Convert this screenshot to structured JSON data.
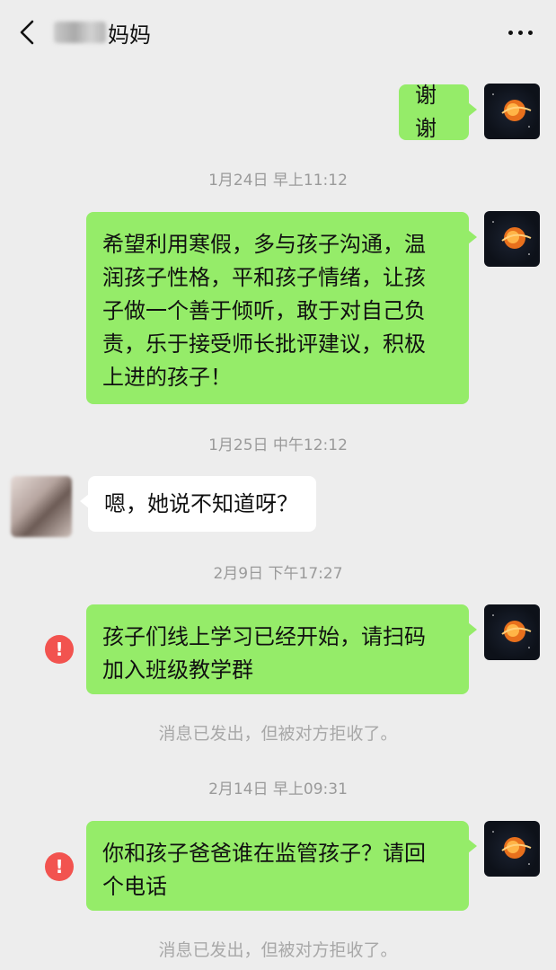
{
  "header": {
    "contact_name": "妈妈"
  },
  "messages": [
    {
      "id": "m1",
      "text": "谢谢"
    },
    {
      "id": "t1",
      "time": "1月24日 早上11:12"
    },
    {
      "id": "m2",
      "text": "希望利用寒假，多与孩子沟通，温\n润孩子性格，平和孩子情绪，让孩\n子做一个善于倾听，敢于对自己负\n责，乐于接受师长批评建议，积极\n上进的孩子！"
    },
    {
      "id": "t2",
      "time": "1月25日 中午12:12"
    },
    {
      "id": "m3",
      "text": "嗯，她说不知道呀？"
    },
    {
      "id": "t3",
      "time": "2月9日 下午17:27"
    },
    {
      "id": "m4",
      "text": "孩子们线上学习已经开始，请扫码\n加入班级教学群"
    },
    {
      "id": "n1",
      "notice": "消息已发出，但被对方拒收了。"
    },
    {
      "id": "t4",
      "time": "2月14日 早上09:31"
    },
    {
      "id": "m5",
      "text": "你和孩子爸爸谁在监管孩子？请回\n个电话"
    },
    {
      "id": "n2",
      "notice": "消息已发出，但被对方拒收了。"
    }
  ],
  "error_glyph": "!",
  "colors": {
    "background": "#ededed",
    "my_bubble": "#95ec69",
    "other_bubble": "#ffffff",
    "error_badge": "#f2534f"
  }
}
